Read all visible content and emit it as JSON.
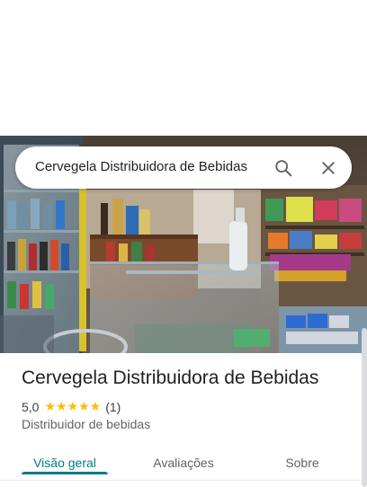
{
  "search": {
    "query": "Cervegela Distribuidora de Bebidas",
    "search_icon": "search-icon",
    "close_icon": "close-icon"
  },
  "place": {
    "name": "Cervegela Distribuidora de Bebidas",
    "rating": "5,0",
    "stars": "★★★★★",
    "star_value": 5,
    "review_count": "(1)",
    "category": "Distribuidor de bebidas"
  },
  "tabs": [
    {
      "label": "Visão geral",
      "active": true
    },
    {
      "label": "Avaliações",
      "active": false
    },
    {
      "label": "Sobre",
      "active": false
    }
  ],
  "colors": {
    "accent": "#007b83",
    "star": "#fbbc04",
    "text_primary": "#202124",
    "text_secondary": "#5f6368"
  }
}
